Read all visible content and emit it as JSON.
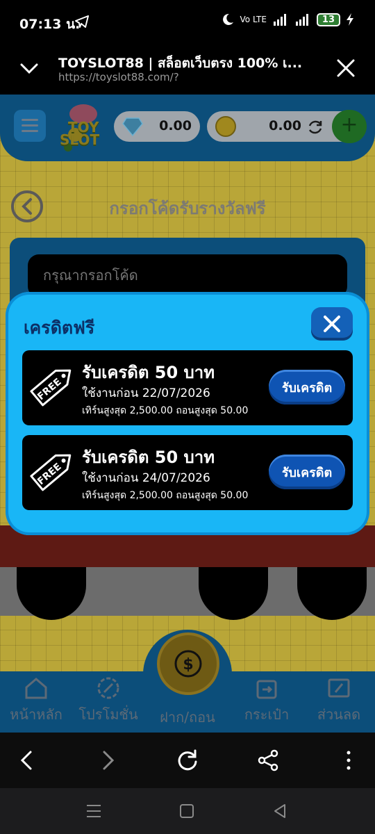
{
  "status": {
    "time": "07:13 น.",
    "network_label": "Vo LTE",
    "battery": "13"
  },
  "browser": {
    "title": "TOYSLOT88 | สล็อตเว็บตรง 100% เ...",
    "url": "https://toyslot88.com/?"
  },
  "site": {
    "logo_line1": "TOY",
    "logo_line2": "SLOT",
    "gem_balance": "0.00",
    "coin_balance": "0.00",
    "redeem_title": "กรอกโค้ดรับรางวัลฟรี",
    "code_placeholder": "กรุณากรอกโค้ด",
    "nav": [
      {
        "label": "หน้าหลัก",
        "icon": "home-icon"
      },
      {
        "label": "โปรโมชั่น",
        "icon": "promotion-icon"
      },
      {
        "label": "ฝาก/ถอน",
        "icon": "deposit-withdraw-icon"
      },
      {
        "label": "กระเป๋า",
        "icon": "wallet-icon"
      },
      {
        "label": "ส่วนลด",
        "icon": "discount-icon"
      }
    ]
  },
  "modal": {
    "title": "เครดิตฟรี",
    "coupons": [
      {
        "tag": "FREE",
        "title": "รับเครดิต 50 บาท",
        "expiry": "ใช้งานก่อน 22/07/2026",
        "limit": "เทิร์นสูงสุด 2,500.00 ถอนสูงสุด 50.00",
        "button": "รับเครดิต"
      },
      {
        "tag": "FREE",
        "title": "รับเครดิต 50 บาท",
        "expiry": "ใช้งานก่อน 24/07/2026",
        "limit": "เทิร์นสูงสุด 2,500.00 ถอนสูงสุด 50.00",
        "button": "รับเครดิต"
      }
    ]
  },
  "colors": {
    "modal_bg": "#19b6f6",
    "claim_button": "#0f54b3",
    "header_blue": "#0c4e7a"
  }
}
